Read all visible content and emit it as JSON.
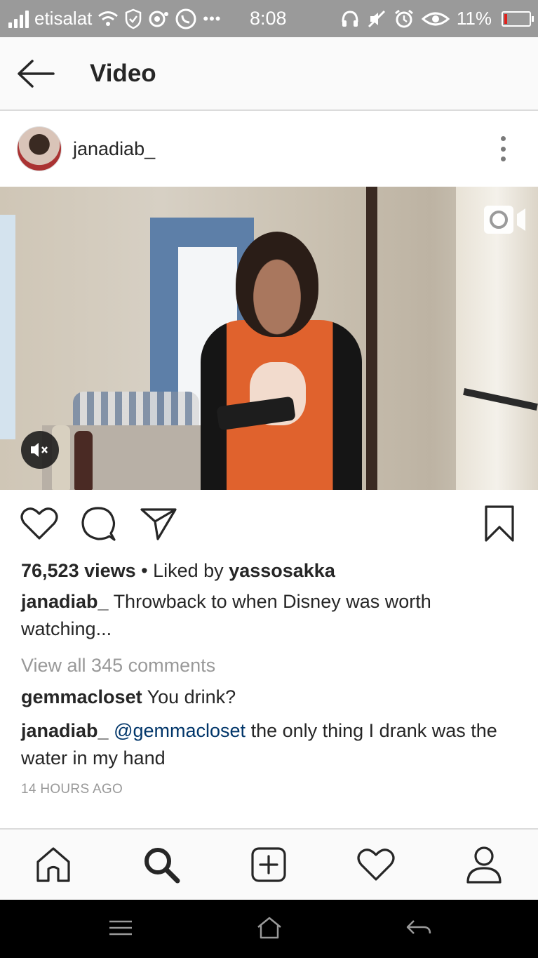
{
  "status_bar": {
    "carrier": "etisalat",
    "time": "8:08",
    "battery": "11%",
    "battery_level": 0.11,
    "icons": [
      "signal-icon",
      "wifi-icon",
      "shield-icon",
      "notification-icon",
      "whatsapp-icon",
      "more-dots-icon",
      "headphones-icon",
      "mute-icon",
      "alarm-icon",
      "eye-icon",
      "battery-icon"
    ]
  },
  "header": {
    "title": "Video"
  },
  "post": {
    "username": "janadiab_",
    "views": "76,523 views",
    "liked_by_prefix": "• Liked by",
    "liked_by_user": "yassosakka",
    "caption_user": "janadiab_",
    "caption_text": "Throwback to when Disney was worth watching...",
    "view_all_comments": "View all 345 comments",
    "comments": [
      {
        "user": "gemmacloset",
        "text": "You drink?"
      },
      {
        "user": "janadiab_",
        "mention": "@gemmacloset",
        "text": "the only thing I drank was the water in my hand"
      }
    ],
    "time_ago": "14 HOURS AGO"
  },
  "colors": {
    "link": "#003569",
    "muted": "#999999",
    "text": "#262626",
    "battery_low": "#e0201b"
  }
}
